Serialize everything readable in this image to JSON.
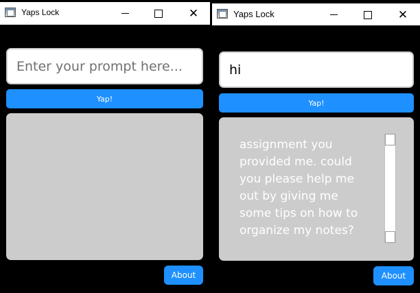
{
  "windows": [
    {
      "title": "Yaps Lock",
      "prompt": {
        "value": "",
        "placeholder": "Enter your prompt here..."
      },
      "yap_label": "Yap!",
      "output_text": "",
      "about_label": "About"
    },
    {
      "title": "Yaps Lock",
      "prompt": {
        "value": "hi",
        "placeholder": "Enter your prompt here..."
      },
      "yap_label": "Yap!",
      "output_text": "assignment you\nprovided me. could\nyou please help me\nout by giving me\nsome tips on how to\norganize my notes?",
      "about_label": "About"
    }
  ],
  "colors": {
    "accent": "#1e90ff",
    "output_bg": "#cccccc",
    "background": "#000000"
  },
  "icons": {
    "app": "app-window-icon",
    "minimize": "minimize-icon",
    "maximize": "maximize-icon",
    "close": "close-icon"
  }
}
